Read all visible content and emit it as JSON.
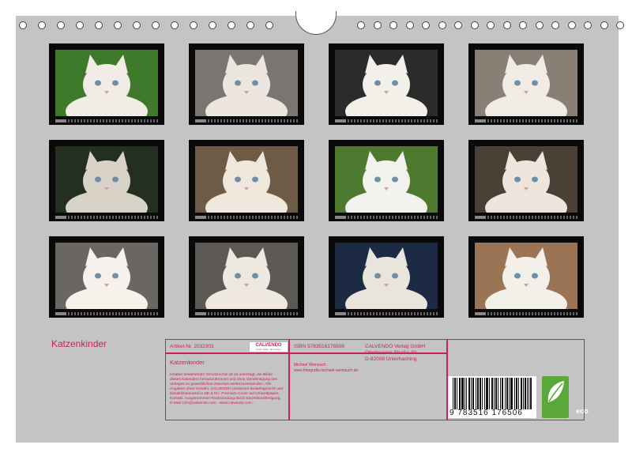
{
  "calendar": {
    "title": "Katzenkinder"
  },
  "photos": [
    {
      "name": "kitten-on-grass-photo",
      "bg": "#3f7a2a",
      "fg": "#f2ece6"
    },
    {
      "name": "kittens-in-basket-photo",
      "bg": "#7a7570",
      "fg": "#ece6de"
    },
    {
      "name": "kitten-portrait-photo",
      "bg": "#2b2b2b",
      "fg": "#f3efe9"
    },
    {
      "name": "kitten-lying-photo",
      "bg": "#8a7f74",
      "fg": "#f0ebe4"
    },
    {
      "name": "calico-kitten-photo",
      "bg": "#23301f",
      "fg": "#d9d2c6"
    },
    {
      "name": "two-kittens-photo",
      "bg": "#6d5b45",
      "fg": "#f0e7dc"
    },
    {
      "name": "white-kitten-on-grass-photo",
      "bg": "#4d7a2e",
      "fg": "#f4f2ee"
    },
    {
      "name": "kittens-on-scratching-post-photo",
      "bg": "#4a4035",
      "fg": "#eee6dc"
    },
    {
      "name": "white-kitten-closeup-photo",
      "bg": "#6a6661",
      "fg": "#f6f1ea"
    },
    {
      "name": "kittens-in-cat-tree-photo",
      "bg": "#5c5853",
      "fg": "#efe8df"
    },
    {
      "name": "kitten-on-blanket-photo",
      "bg": "#1d2a44",
      "fg": "#e9e4dc"
    },
    {
      "name": "kitten-resting-photo",
      "bg": "#9a7455",
      "fg": "#f3efe9"
    }
  ],
  "info_box": {
    "article": "Artikel-Nr. 2032303",
    "subtitle": "Katzenkinder",
    "legal": "Inhaber bestehender Schutzrechte ist es untersagt, die Bilder dieses Kalenders herauszutrennen und ohne Genehmigung des Verlages zu gewerblichen Zwecken weiterzuverwenden. Alle Angaben ohne Gewähr. CALVENDO produziert bedarfsgerecht und klimaklimaneutral in DE & EU. Premium-Cover auf Umweltpapier, Kontakt. Ausgenommen-Rücksendung durch Einzelstückfertigung. E-Mail: info@calvendo.com - www.calvendo.com",
    "logo": "CALVENDO",
    "logo_sub": "Kunst. Natur. Menschen.",
    "isbn": "ISBN 9783516176506",
    "author": "Michael Weinauch",
    "author_url": "www.fotografie.michael-weinauch.de",
    "publisher_name": "CALVENDO Verlag GmbH",
    "publisher_street": "Ottobrunner Straße 39",
    "publisher_city": "D-82008 Unterhaching",
    "barcode_digits": "9 783516 176506",
    "eco_label": "eco"
  },
  "colors": {
    "accent": "#c8205d",
    "page_bg": "#c4c4c4",
    "frame": "#0a0a0a"
  }
}
